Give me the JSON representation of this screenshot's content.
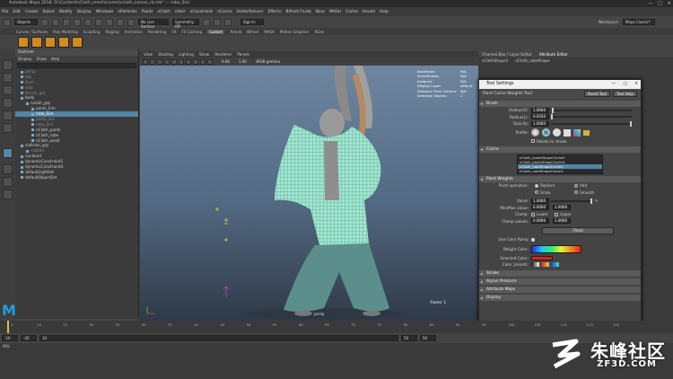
{
  "window": {
    "title": "Autodesk Maya 2018: D:\\Content\\nCloth_mesh\\scenes\\ncloth_kensai_rb.mb* --- robe_Sim",
    "controls": [
      "—",
      "□",
      "✕"
    ]
  },
  "menubar": [
    "File",
    "Edit",
    "Create",
    "Select",
    "Modify",
    "Display",
    "Windows",
    "nParticles",
    "Fluids",
    "nCloth",
    "nHair",
    "nConstraint",
    "nCache",
    "Fields/Solvers",
    "Effects",
    "Bifrost Fluids",
    "Boss",
    "MASH",
    "Cache",
    "Arnold",
    "Help"
  ],
  "statusline": {
    "mode": "Objects",
    "live_surface": "No Live Surface",
    "symmetry": "Symmetry: Off",
    "signin": "Sign In",
    "workspace_label": "Workspace:",
    "workspace": "Maya Classic*"
  },
  "shelf_tabs": [
    "Curves / Surfaces",
    "Poly Modeling",
    "Sculpting",
    "Rigging",
    "Animation",
    "Rendering",
    "FX",
    "FX Caching",
    "Custom",
    "Arnold",
    "Bifrost",
    "MASH",
    "Motion Graphics",
    "XGen"
  ],
  "shelf_active": "Custom",
  "outliner": {
    "title": "Outliner",
    "menu": [
      "Display",
      "Show",
      "Help"
    ],
    "items": [
      {
        "label": "persp",
        "dim": true
      },
      {
        "label": "top",
        "dim": true
      },
      {
        "label": "front",
        "dim": true
      },
      {
        "label": "side",
        "dim": true
      },
      {
        "label": "kensai_grp",
        "dim": true
      },
      {
        "label": "body",
        "dim": false
      },
      {
        "label": "ncloth_grp",
        "dim": false
      },
      {
        "label": "pants_Sim",
        "dim": false
      },
      {
        "label": "robe_Sim",
        "dim": false,
        "selected": true
      },
      {
        "label": "pants_sim",
        "dim": true
      },
      {
        "label": "robe_Sim",
        "dim": true
      },
      {
        "label": "nCloth_pants",
        "dim": false
      },
      {
        "label": "nCloth_robe",
        "dim": false
      },
      {
        "label": "nCloth_waist",
        "dim": false
      },
      {
        "label": "collision_grp",
        "dim": false
      },
      {
        "label": "collider",
        "dim": true
      },
      {
        "label": "nucleus1",
        "dim": false
      },
      {
        "label": "dynamicConstraint1",
        "dim": false
      },
      {
        "label": "dynamicConstraint4",
        "dim": false
      },
      {
        "label": "defaultLightSet",
        "dim": false
      },
      {
        "label": "defaultObjectSet",
        "dim": false
      }
    ]
  },
  "viewport": {
    "menu": [
      "View",
      "Shading",
      "Lighting",
      "Show",
      "Renderer",
      "Panels"
    ],
    "hud": [
      {
        "k": "Backfaces:",
        "v": "N/A"
      },
      {
        "k": "Smoothness:",
        "v": "N/A"
      },
      {
        "k": "Instance:",
        "v": "N/A"
      },
      {
        "k": "Display Layer:",
        "v": "default"
      },
      {
        "k": "Distance From Camera:",
        "v": "N/A"
      },
      {
        "k": "Selected Objects:",
        "v": "1"
      }
    ],
    "frame_label": "Frame:",
    "frame_value": "1",
    "camera": "persp",
    "colorspace": "sRGB gamma",
    "exposure": "0.00",
    "gamma": "1.00"
  },
  "right_panel": {
    "tabs": [
      "Channel Box / Layer Editor",
      "Attribute Editor"
    ],
    "node_tab": "nClothShape1",
    "node_tab2": "nCloth_robeShape"
  },
  "tool_settings": {
    "title": "Tool Settings",
    "tool_name": "Paint Cache Weights Tool",
    "reset": "Reset Tool",
    "help": "Tool Help",
    "brush": {
      "header": "Brush",
      "radius_u_label": "Radius(U):",
      "radius_u": "1.0000",
      "radius_l_label": "Radius(L):",
      "radius_l": "0.0250",
      "opacity_label": "Opacity:",
      "opacity": "1.0000",
      "profile_label": "Profile:",
      "rotate_label": "Rotate to stroke"
    },
    "cache": {
      "header": "Cache",
      "items": [
        "nCloth_lowerShapeCache1",
        "nCloth_pantsShapeCache1",
        "nCloth_robeShapeCache1",
        "nCloth_robeShapeCache2"
      ],
      "selected_index": 2
    },
    "paint_weights": {
      "header": "Paint Weights",
      "operation_label": "Paint operation:",
      "ops": [
        "Replace",
        "Add",
        "Scale",
        "Smooth"
      ],
      "value_label": "Value:",
      "value": "1.0000",
      "minmax_label": "Min/Max value:",
      "min": "0.0000",
      "max": "1.0000",
      "clamp_label": "Clamp:",
      "clamp_lower": "Lower",
      "clamp_upper": "Upper",
      "clamp_values_label": "Clamp values:",
      "clamp_min": "0.0000",
      "clamp_max": "1.0000",
      "flood": "Flood",
      "use_color_ramp": "Use Color Ramp",
      "weight_colors": "Weight Color:",
      "selected_color": "Selected Color:",
      "color_ramp_label": "Color presets:"
    },
    "closed_sections": [
      "Stroke",
      "Stylus Pressure",
      "Attribute Maps",
      "Display"
    ]
  },
  "timeline": {
    "ticks": [
      "5",
      "10",
      "15",
      "20",
      "25",
      "30",
      "35",
      "40",
      "45",
      "50",
      "55",
      "60",
      "65",
      "70",
      "75",
      "80",
      "85",
      "90",
      "95",
      "100",
      "105",
      "110",
      "115",
      "120"
    ],
    "current": "1"
  },
  "range": {
    "start": "-10",
    "play_start": "-20",
    "current": "10",
    "end": "50",
    "play_end": "50"
  },
  "command_line": {
    "label": "MEL"
  },
  "watermark": {
    "main": "朱峰社区",
    "sub": "ZF3D.COM"
  },
  "colors": {
    "accent": "#5285a6",
    "shelf_icon": "#d48a1c",
    "cloth": "#9fe6d0",
    "pants": "#5c8f8c"
  }
}
